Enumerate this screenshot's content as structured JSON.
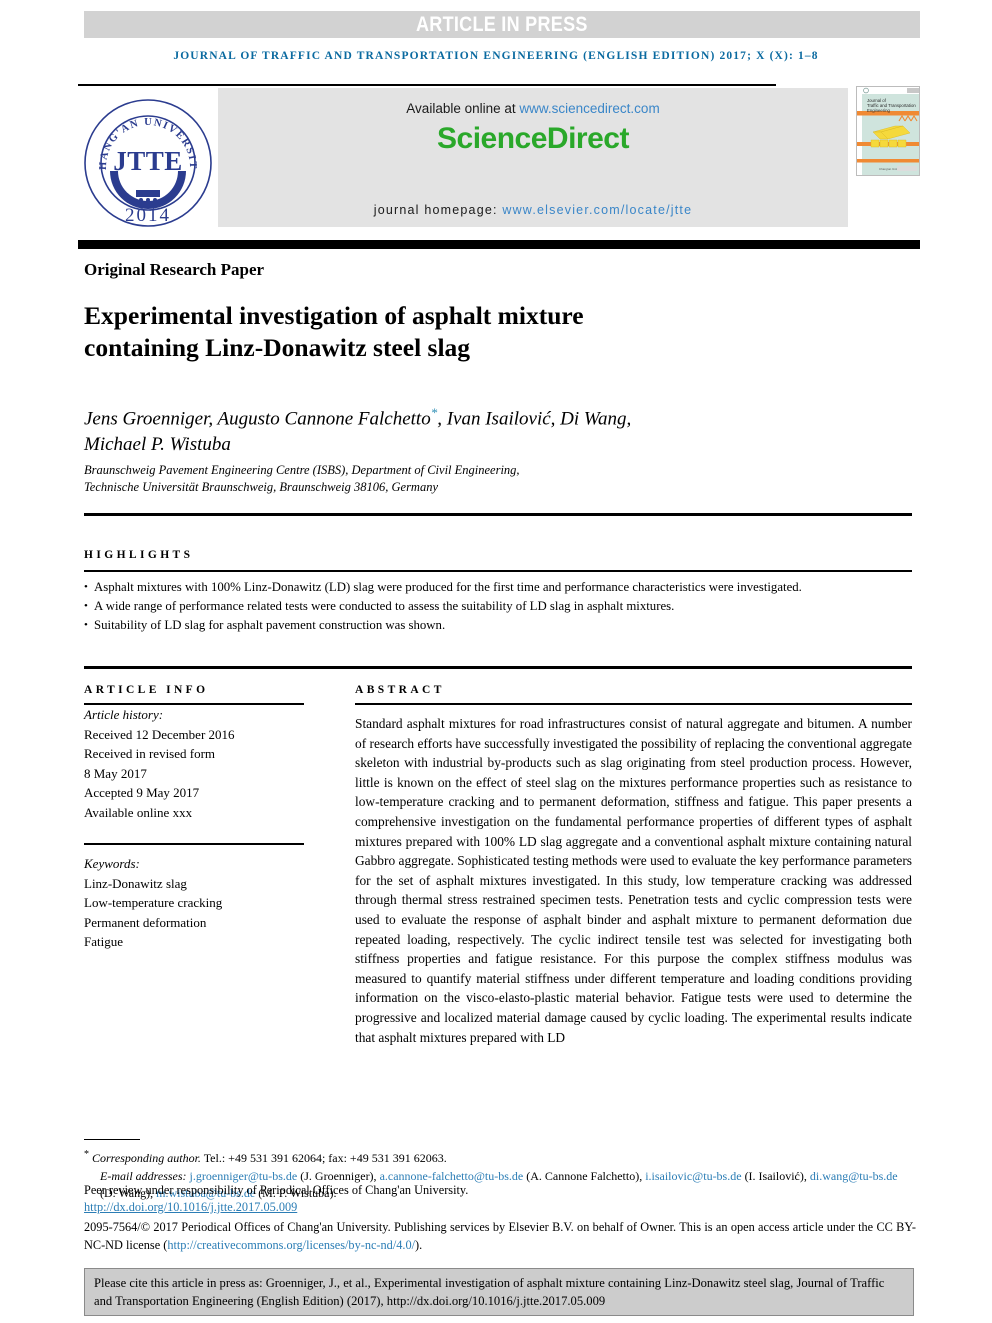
{
  "banner": {
    "text": "ARTICLE IN PRESS"
  },
  "running_head": "JOURNAL OF TRAFFIC AND TRANSPORTATION ENGINEERING (ENGLISH EDITION) 2017; X (X): 1–8",
  "masthead": {
    "logo": {
      "top_arc": "CHANG'AN UNIVERSITY",
      "center": "JTTE",
      "year": "2014"
    },
    "sciencedirect": {
      "available_prefix": "Available online at ",
      "available_url": "www.sciencedirect.com",
      "wordmark": "ScienceDirect",
      "homepage_prefix": "journal homepage: ",
      "homepage_url": "www.elsevier.com/locate/jtte"
    },
    "cover": {
      "line1": "Journal of",
      "line2": "Traffic and Transportation",
      "line3": "Engineering",
      "line3_sub": "(English Edition)",
      "footer_left": "Chang'an University"
    }
  },
  "article": {
    "type_label": "Original Research Paper",
    "title_line1": "Experimental investigation of asphalt mixture",
    "title_line2": "containing Linz-Donawitz steel slag",
    "authors_line1": "Jens Groenniger, Augusto Cannone Falchetto",
    "authors_star": "*",
    "authors_line1_cont": ", Ivan Isailović, Di Wang,",
    "authors_line2": "Michael P. Wistuba",
    "affiliation_line1": "Braunschweig Pavement Engineering Centre (ISBS), Department of Civil Engineering,",
    "affiliation_line2": "Technische Universität Braunschweig, Braunschweig 38106, Germany"
  },
  "highlights": {
    "heading": "HIGHLIGHTS",
    "items": [
      "Asphalt mixtures with 100% Linz-Donawitz (LD) slag were produced for the first time and performance characteristics were investigated.",
      "A wide range of performance related tests were conducted to assess the suitability of LD slag in asphalt mixtures.",
      "Suitability of LD slag for asphalt pavement construction was shown."
    ]
  },
  "article_info": {
    "heading": "ARTICLE INFO",
    "history_label": "Article history:",
    "received": "Received 12 December 2016",
    "revised_label": "Received in revised form",
    "revised_date": "8 May 2017",
    "accepted": "Accepted 9 May 2017",
    "available": "Available online xxx",
    "keywords_label": "Keywords:",
    "keywords": [
      "Linz-Donawitz slag",
      "Low-temperature cracking",
      "Permanent deformation",
      "Fatigue"
    ]
  },
  "abstract": {
    "heading": "ABSTRACT",
    "body": "Standard asphalt mixtures for road infrastructures consist of natural aggregate and bitumen. A number of research efforts have successfully investigated the possibility of replacing the conventional aggregate skeleton with industrial by-products such as slag originating from steel production process. However, little is known on the effect of steel slag on the mixtures performance properties such as resistance to low-temperature cracking and to permanent deformation, stiffness and fatigue. This paper presents a comprehensive investigation on the fundamental performance properties of different types of asphalt mixtures prepared with 100% LD slag aggregate and a conventional asphalt mixture containing natural Gabbro aggregate. Sophisticated testing methods were used to evaluate the key performance parameters for the set of asphalt mixtures investigated. In this study, low temperature cracking was addressed through thermal stress restrained specimen tests. Penetration tests and cyclic compression tests were used to evaluate the response of asphalt binder and asphalt mixture to permanent deformation due repeated loading, respectively. The cyclic indirect tensile test was selected for investigating both stiffness properties and fatigue resistance. For this purpose the complex stiffness modulus was measured to quantify material stiffness under different temperature and loading conditions providing information on the visco-elasto-plastic material behavior. Fatigue tests were used to determine the progressive and localized material damage caused by cyclic loading. The experimental results indicate that asphalt mixtures prepared with LD"
  },
  "footnotes": {
    "corresponding_star": "*",
    "corresponding_ital": "Corresponding author.",
    "corresponding_rest": " Tel.: +49 531 391 62064; fax: +49 531 391 62063.",
    "email_label": "E-mail addresses: ",
    "emails": [
      {
        "address": "j.groenniger@tu-bs.de",
        "name": " (J. Groenniger), "
      },
      {
        "address": "a.cannone-falchetto@tu-bs.de",
        "name": " (A. Cannone Falchetto), "
      },
      {
        "address": "i.isailovic@tu-bs.de",
        "name": " (I. Isailović), "
      },
      {
        "address": "di.wang@tu-bs.de",
        "name": " (D. Wang), "
      },
      {
        "address": "m.wistuba@tu-bs.de",
        "name": " (M. P. Wistuba)."
      }
    ],
    "peer_review": "Peer review under responsibility of Periodical Offices of Chang'an University.",
    "doi": "http://dx.doi.org/10.1016/j.jtte.2017.05.009",
    "copyright_part1": "2095-7564/© 2017 Periodical Offices of Chang'an University. Publishing services by Elsevier B.V. on behalf of Owner. This is an open access article under the CC BY-NC-ND license (",
    "copyright_link": "http://creativecommons.org/licenses/by-nc-nd/4.0/",
    "copyright_part2": ")."
  },
  "cite_box": {
    "text": "Please cite this article in press as: Groenniger, J., et al., Experimental investigation of asphalt mixture containing Linz-Donawitz steel slag, Journal of Traffic and Transportation Engineering (English Edition) (2017), http://dx.doi.org/10.1016/j.jtte.2017.05.009"
  },
  "colors": {
    "banner_bg": "#d2d2d2",
    "running_head": "#0a6aa0",
    "sciencedirect_green": "#2aa82a",
    "link_blue": "#2b7db5",
    "logo_blue": "#2b3c8f",
    "cover_teal": "#cfe4dd",
    "cover_orange": "#f08a33",
    "cover_yellow": "#f5d93c"
  }
}
